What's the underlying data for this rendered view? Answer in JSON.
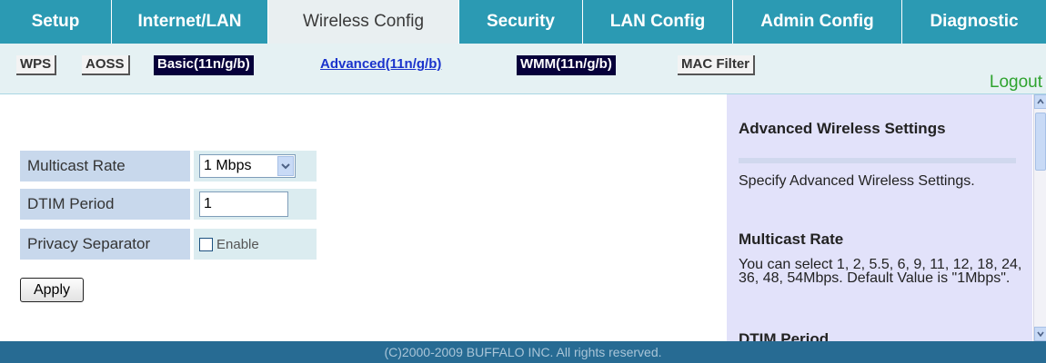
{
  "top_tabs": [
    {
      "label": "Setup",
      "active": false
    },
    {
      "label": "Internet/LAN",
      "active": false
    },
    {
      "label": "Wireless Config",
      "active": true
    },
    {
      "label": "Security",
      "active": false
    },
    {
      "label": "LAN Config",
      "active": false
    },
    {
      "label": "Admin Config",
      "active": false
    },
    {
      "label": "Diagnostic",
      "active": false
    }
  ],
  "sub_tabs": [
    {
      "label": "WPS"
    },
    {
      "label": "AOSS"
    },
    {
      "label": "Basic(11n/g/b)"
    },
    {
      "label": "Advanced(11n/g/b)",
      "active": true
    },
    {
      "label": "WMM(11n/g/b)"
    },
    {
      "label": "MAC Filter"
    }
  ],
  "logout_label": "Logout",
  "form": {
    "multicast_rate": {
      "label": "Multicast Rate",
      "value": "1 Mbps"
    },
    "dtim_period": {
      "label": "DTIM Period",
      "value": "1"
    },
    "privacy_separator": {
      "label": "Privacy Separator",
      "checkbox_label": "Enable",
      "checked": false
    },
    "apply_label": "Apply"
  },
  "help": {
    "title": "Advanced Wireless Settings",
    "intro": "Specify Advanced Wireless Settings.",
    "multicast_heading": "Multicast Rate",
    "multicast_text": "You can select 1, 2, 5.5, 6, 9, 11, 12, 18, 24, 36, 48, 54Mbps. Default Value is \"1Mbps\".",
    "dtim_heading": "DTIM Period"
  },
  "footer": "(C)2000-2009 BUFFALO INC. All rights reserved.",
  "colors": {
    "nav": "#2b9ab3",
    "subnav_bg": "#e5f1f3",
    "help_bg": "#e2e2fa",
    "footer": "#276b93",
    "logout": "#2ea32e"
  }
}
